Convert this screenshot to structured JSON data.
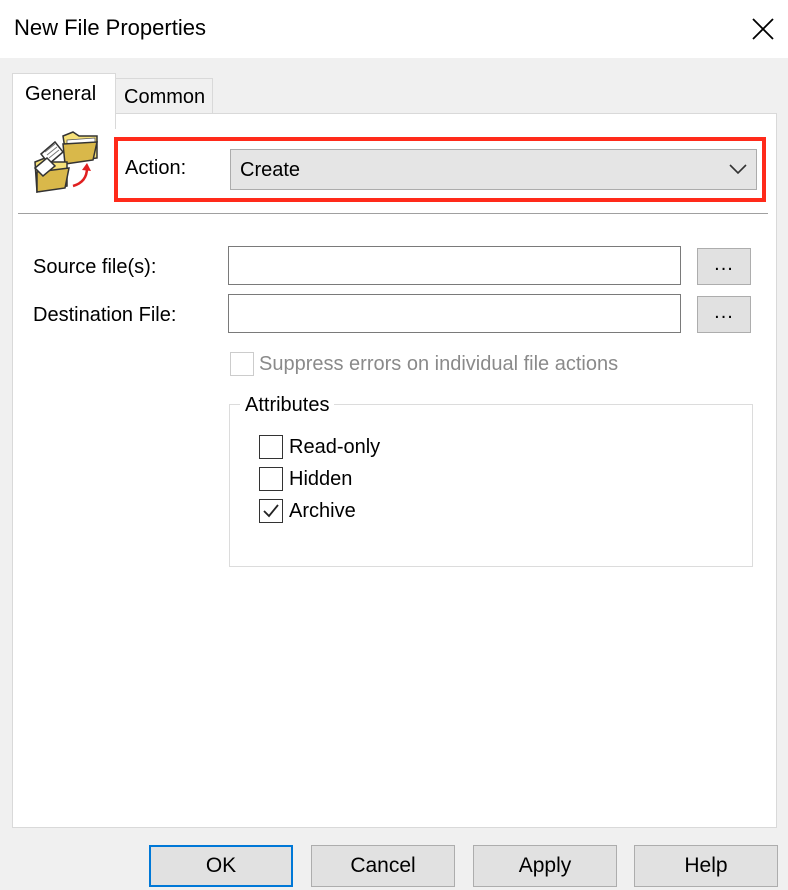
{
  "window": {
    "title": "New File Properties"
  },
  "tabs": [
    {
      "label": "General",
      "active": true
    },
    {
      "label": "Common",
      "active": false
    }
  ],
  "general": {
    "action_label": "Action:",
    "action_value": "Create",
    "source_label": "Source file(s):",
    "source_value": "",
    "destination_label": "Destination File:",
    "destination_value": "",
    "browse_label": "...",
    "suppress_label": "Suppress errors on individual file actions",
    "suppress_checked": false,
    "attributes": {
      "title": "Attributes",
      "items": [
        {
          "label": "Read-only",
          "checked": false
        },
        {
          "label": "Hidden",
          "checked": false
        },
        {
          "label": "Archive",
          "checked": true
        }
      ]
    }
  },
  "buttons": {
    "ok": "OK",
    "cancel": "Cancel",
    "apply": "Apply",
    "help": "Help"
  },
  "icons": {
    "close": "close-icon",
    "file": "file-copy-icon",
    "dropdown": "chevron-down-icon",
    "check": "checkmark-icon"
  },
  "colors": {
    "highlight": "#ff2a1a",
    "default_button_border": "#0078d7"
  }
}
